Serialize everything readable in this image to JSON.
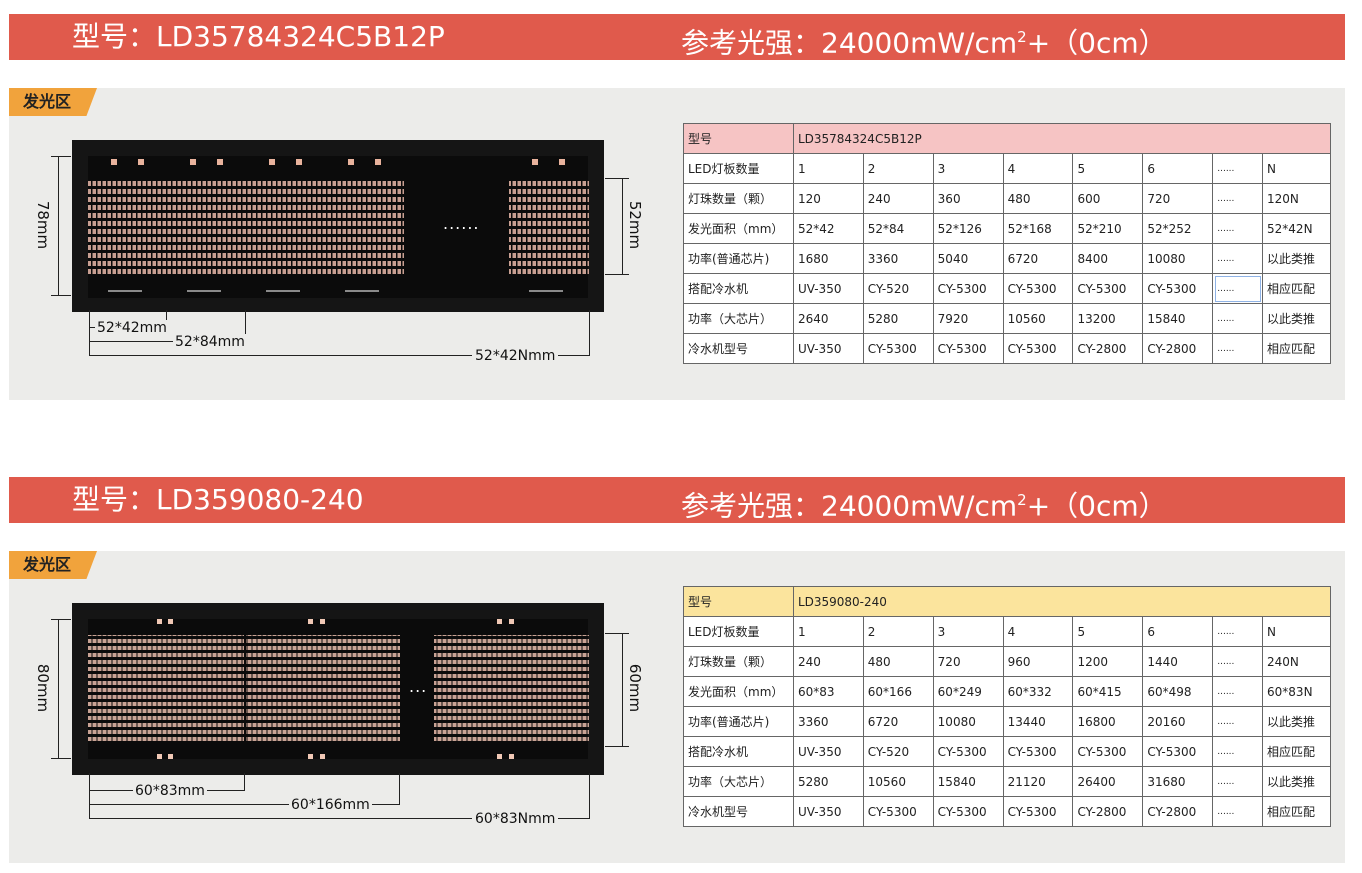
{
  "products": [
    {
      "banner": {
        "model_label": "型号：LD35784324C5B12P",
        "ref_prefix": "参考光强：24000mW/cm",
        "ref_sup": "2",
        "ref_suffix": "+（0cm）"
      },
      "area_tag": "发光区",
      "diagram": {
        "height_label": "78mm",
        "emit_height_label": "52mm",
        "ellipsis": "......",
        "width_1": "52*42mm",
        "width_2": "52*84mm",
        "width_n": "52*42Nmm"
      },
      "table": {
        "rows": [
          [
            "型号",
            "LD35784324C5B12P"
          ],
          [
            "LED灯板数量",
            "1",
            "2",
            "3",
            "4",
            "5",
            "6",
            "......",
            "N"
          ],
          [
            "灯珠数量（颗）",
            "120",
            "240",
            "360",
            "480",
            "600",
            "720",
            "......",
            "120N"
          ],
          [
            "发光面积（mm）",
            "52*42",
            "52*84",
            "52*126",
            "52*168",
            "52*210",
            "52*252",
            "......",
            "52*42N"
          ],
          [
            "功率(普通芯片)",
            "1680",
            "3360",
            "5040",
            "6720",
            "8400",
            "10080",
            "......",
            "以此类推"
          ],
          [
            "搭配冷水机",
            "UV-350",
            "CY-520",
            "CY-5300",
            "CY-5300",
            "CY-5300",
            "CY-5300",
            "......",
            "相应匹配"
          ],
          [
            "功率（大芯片）",
            "2640",
            "5280",
            "7920",
            "10560",
            "13200",
            "15840",
            "......",
            "以此类推"
          ],
          [
            "冷水机型号",
            "UV-350",
            "CY-5300",
            "CY-5300",
            "CY-5300",
            "CY-2800",
            "CY-2800",
            "......",
            "相应匹配"
          ]
        ]
      }
    },
    {
      "banner": {
        "model_label": "型号：LD359080-240",
        "ref_prefix": "参考光强：24000mW/cm",
        "ref_sup": "2",
        "ref_suffix": "+（0cm）"
      },
      "area_tag": "发光区",
      "diagram": {
        "height_label": "80mm",
        "emit_height_label": "60mm",
        "ellipsis": "...",
        "width_1": "60*83mm",
        "width_2": "60*166mm",
        "width_n": "60*83Nmm"
      },
      "table": {
        "rows": [
          [
            "型号",
            "LD359080-240"
          ],
          [
            "LED灯板数量",
            "1",
            "2",
            "3",
            "4",
            "5",
            "6",
            "......",
            "N"
          ],
          [
            "灯珠数量（颗）",
            "240",
            "480",
            "720",
            "960",
            "1200",
            "1440",
            "......",
            "240N"
          ],
          [
            "发光面积（mm）",
            "60*83",
            "60*166",
            "60*249",
            "60*332",
            "60*415",
            "60*498",
            "......",
            "60*83N"
          ],
          [
            "功率(普通芯片)",
            "3360",
            "6720",
            "10080",
            "13440",
            "16800",
            "20160",
            "......",
            "以此类推"
          ],
          [
            "搭配冷水机",
            "UV-350",
            "CY-520",
            "CY-5300",
            "CY-5300",
            "CY-5300",
            "CY-5300",
            "......",
            "相应匹配"
          ],
          [
            "功率（大芯片）",
            "5280",
            "10560",
            "15840",
            "21120",
            "26400",
            "31680",
            "......",
            "以此类推"
          ],
          [
            "冷水机型号",
            "UV-350",
            "CY-5300",
            "CY-5300",
            "CY-5300",
            "CY-2800",
            "CY-2800",
            "......",
            "相应匹配"
          ]
        ]
      }
    }
  ]
}
